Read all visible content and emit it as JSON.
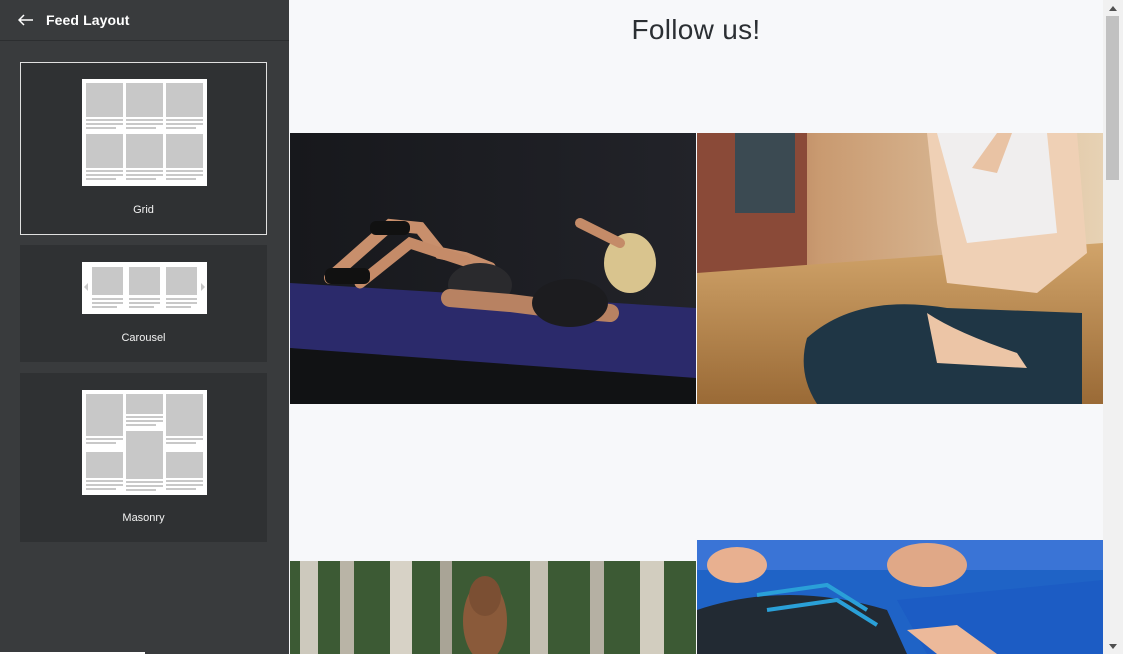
{
  "sidebar": {
    "title": "Feed Layout",
    "back_icon": "arrow-left-icon",
    "options": [
      {
        "label": "Grid",
        "selected": true
      },
      {
        "label": "Carousel",
        "selected": false
      },
      {
        "label": "Masonry",
        "selected": false
      }
    ]
  },
  "main": {
    "title": "Follow us!"
  },
  "colors": {
    "sidebar_bg": "#393b3d",
    "card_bg": "#2f3133",
    "page_bg": "#f7f8fa",
    "title_text": "#2b2f33"
  }
}
